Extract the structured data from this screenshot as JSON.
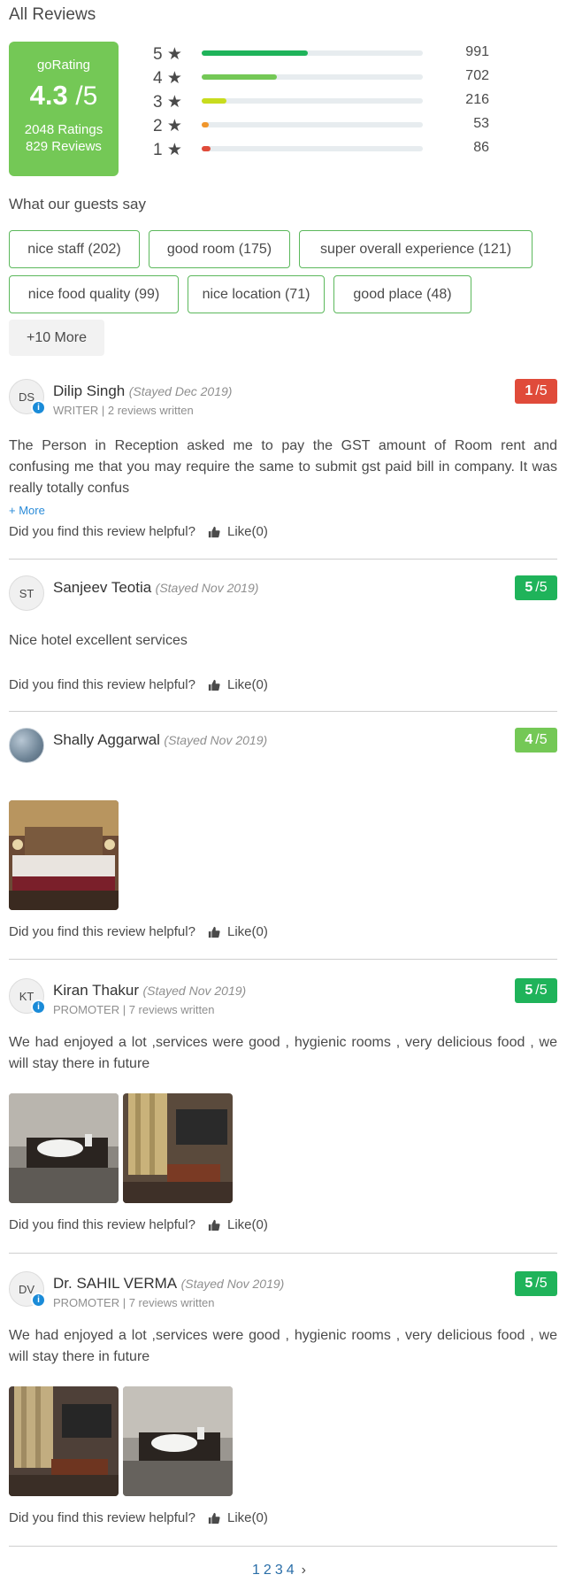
{
  "page_title": "All Reviews",
  "summary": {
    "label": "goRating",
    "score": "4.3",
    "out_of": "/5",
    "ratings_text": "2048 Ratings",
    "reviews_text": "829 Reviews",
    "color": "#74c856"
  },
  "distribution": [
    {
      "stars": "5",
      "count": "991",
      "fraction": 0.48,
      "color": "#1fb35a"
    },
    {
      "stars": "4",
      "count": "702",
      "fraction": 0.34,
      "color": "#74c856"
    },
    {
      "stars": "3",
      "count": "216",
      "fraction": 0.11,
      "color": "#c8dc1e"
    },
    {
      "stars": "2",
      "count": "53",
      "fraction": 0.03,
      "color": "#f0962c"
    },
    {
      "stars": "1",
      "count": "86",
      "fraction": 0.04,
      "color": "#e04b3a"
    }
  ],
  "star_glyph": "★",
  "guests": {
    "title": "What our guests say",
    "tags": [
      "nice staff (202)",
      "good room (175)",
      "super overall experience (121)",
      "nice food quality (99)",
      "nice location (71)",
      "good place (48)"
    ],
    "more_label": "+10 More"
  },
  "reviews": [
    {
      "initials": "DS",
      "name": "Dilip Singh",
      "stayed": "(Stayed Dec 2019)",
      "meta": "WRITER | 2 reviews written",
      "score": "1",
      "out_of": "/5",
      "score_color": "#e04b3a",
      "text": "The Person in Reception asked me to pay the GST amount of Room rent and confusing me that you may require the same to submit gst paid bill in company. It was really totally confus",
      "read_more": "+ More",
      "helpful": "Did you find this review helpful?",
      "like": "Like(0)"
    },
    {
      "initials": "ST",
      "name": "Sanjeev Teotia",
      "stayed": "(Stayed Nov 2019)",
      "score": "5",
      "out_of": "/5",
      "score_color": "#1fb35a",
      "text": "Nice hotel excellent services",
      "helpful": "Did you find this review helpful?",
      "like": "Like(0)"
    },
    {
      "name": "Shally Aggarwal",
      "stayed": "(Stayed Nov 2019)",
      "score": "4",
      "out_of": "/5",
      "score_color": "#74c856",
      "helpful": "Did you find this review helpful?",
      "like": "Like(0)"
    },
    {
      "initials": "KT",
      "name": "Kiran Thakur",
      "stayed": "(Stayed Nov 2019)",
      "meta": "PROMOTER | 7 reviews written",
      "score": "5",
      "out_of": "/5",
      "score_color": "#1fb35a",
      "text": "We had enjoyed a lot ,services were good , hygienic rooms , very delicious food , we will stay there in future",
      "helpful": "Did you find this review helpful?",
      "like": "Like(0)"
    },
    {
      "initials": "DV",
      "name": "Dr. SAHIL VERMA",
      "stayed": "(Stayed Nov 2019)",
      "meta": "PROMOTER | 7 reviews written",
      "score": "5",
      "out_of": "/5",
      "score_color": "#1fb35a",
      "text": "We had enjoyed a lot ,services were good , hygienic rooms , very delicious food , we will stay there in future",
      "helpful": "Did you find this review helpful?",
      "like": "Like(0)"
    }
  ],
  "badge_glyph": "i",
  "pagination": {
    "pages": [
      "1",
      "2",
      "3",
      "4"
    ],
    "next": "›"
  }
}
